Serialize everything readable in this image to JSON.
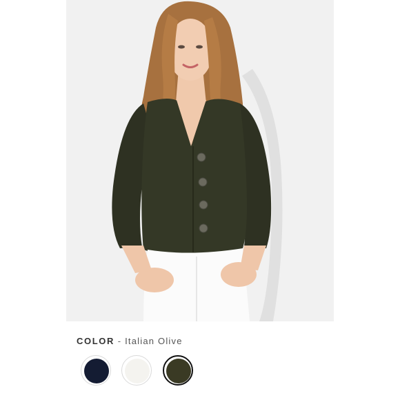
{
  "product_image": {
    "alt": "Woman wearing an olive green button-front cardigan and white jeans"
  },
  "color_selector": {
    "label": "COLOR",
    "separator": "-",
    "selected_value": "Italian Olive",
    "swatches": [
      {
        "name": "navy",
        "hex": "#141c33",
        "selected": false
      },
      {
        "name": "white",
        "hex": "#f4f3ef",
        "selected": false
      },
      {
        "name": "italian-olive",
        "hex": "#3a3a24",
        "selected": true
      }
    ]
  }
}
